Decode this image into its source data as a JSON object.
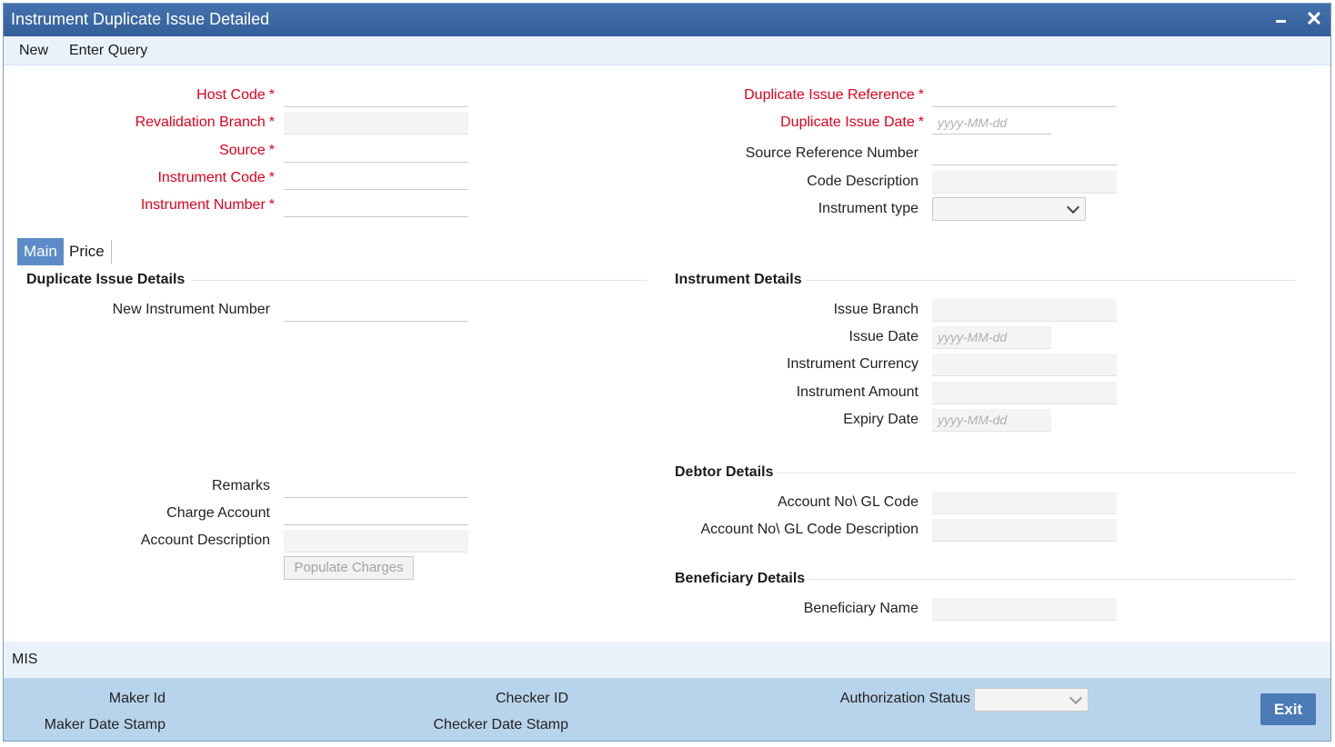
{
  "window": {
    "title": "Instrument Duplicate Issue Detailed"
  },
  "menu": {
    "new": "New",
    "enter_query": "Enter Query"
  },
  "header_left": {
    "host_code": "Host Code",
    "revalidation_branch": "Revalidation Branch",
    "source": "Source",
    "instrument_code": "Instrument Code",
    "instrument_number": "Instrument Number",
    "required_mark": "*"
  },
  "header_right": {
    "duplicate_issue_reference": "Duplicate Issue Reference",
    "duplicate_issue_date": "Duplicate Issue Date",
    "source_reference_number": "Source Reference Number",
    "code_description": "Code Description",
    "instrument_type": "Instrument type",
    "required_mark": "*"
  },
  "date_placeholder": "yyyy-MM-dd",
  "tabs": {
    "main": "Main",
    "price": "Price"
  },
  "duplicate_issue_details": {
    "heading": "Duplicate Issue Details",
    "new_instrument_number": "New Instrument Number",
    "remarks": "Remarks",
    "charge_account": "Charge Account",
    "account_description": "Account Description",
    "populate_charges": "Populate Charges"
  },
  "instrument_details": {
    "heading": "Instrument Details",
    "issue_branch": "Issue Branch",
    "issue_date": "Issue Date",
    "instrument_currency": "Instrument Currency",
    "instrument_amount": "Instrument Amount",
    "expiry_date": "Expiry Date"
  },
  "debtor_details": {
    "heading": "Debtor Details",
    "account_gl_code": "Account No\\ GL Code",
    "account_gl_code_description": "Account No\\ GL Code Description"
  },
  "beneficiary_details": {
    "heading": "Beneficiary Details",
    "beneficiary_name": "Beneficiary Name"
  },
  "mis": {
    "label": "MIS"
  },
  "footer": {
    "maker_id": "Maker Id",
    "maker_date_stamp": "Maker Date Stamp",
    "checker_id": "Checker ID",
    "checker_date_stamp": "Checker Date Stamp",
    "authorization_status": "Authorization Status",
    "exit": "Exit"
  },
  "colors": {
    "title_bar": "#3f6aa3",
    "required_label": "#e0001b",
    "active_tab": "#5b8cc8",
    "footer_bg": "#b8d4ec",
    "exit_button": "#4a7bb7"
  },
  "icons": {
    "minimize": "minimize-icon",
    "close": "close-icon",
    "dropdown": "chevron-down-icon"
  }
}
